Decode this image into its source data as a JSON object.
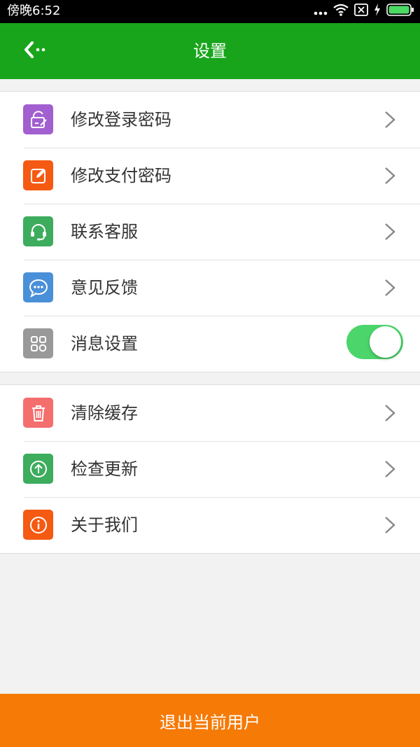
{
  "status_bar": {
    "time": "傍晚6:52",
    "icons": [
      "more-dots-icon",
      "wifi-icon",
      "sim-off-icon",
      "charging-icon",
      "battery-icon"
    ]
  },
  "header": {
    "title": "设置",
    "back_icon": "back-arrow-icon"
  },
  "groups": [
    {
      "items": [
        {
          "label": "修改登录密码",
          "icon": "lock-edit-icon",
          "icon_color": "#a25fd0",
          "control": "chevron"
        },
        {
          "label": "修改支付密码",
          "icon": "edit-icon",
          "icon_color": "#f55a13",
          "control": "chevron"
        },
        {
          "label": "联系客服",
          "icon": "headset-icon",
          "icon_color": "#3dac5d",
          "control": "chevron"
        },
        {
          "label": "意见反馈",
          "icon": "chat-bubble-icon",
          "icon_color": "#4a90d9",
          "control": "chevron"
        },
        {
          "label": "消息设置",
          "icon": "grid-icon",
          "icon_color": "#999999",
          "control": "toggle",
          "toggle_on": true
        }
      ]
    },
    {
      "items": [
        {
          "label": "清除缓存",
          "icon": "trash-icon",
          "icon_color": "#f46e6e",
          "control": "chevron"
        },
        {
          "label": "检查更新",
          "icon": "upload-circle-icon",
          "icon_color": "#3dac5d",
          "control": "chevron"
        },
        {
          "label": "关于我们",
          "icon": "info-icon",
          "icon_color": "#f55a13",
          "control": "chevron"
        }
      ]
    }
  ],
  "logout_label": "退出当前用户",
  "colors": {
    "header_bg": "#18a51b",
    "logout_bg": "#f57a06",
    "toggle_on": "#4bd56a"
  }
}
